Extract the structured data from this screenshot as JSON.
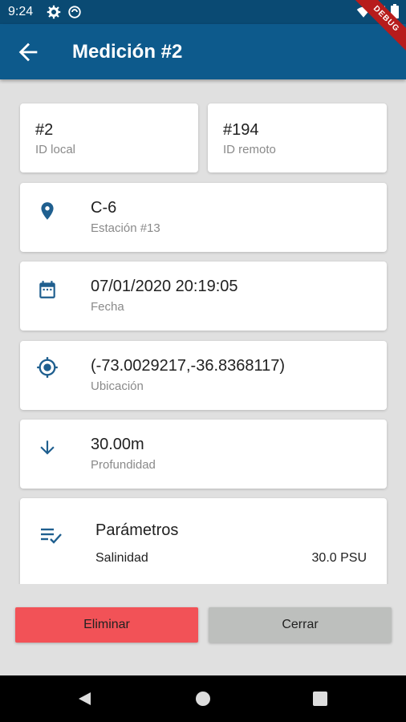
{
  "status_bar": {
    "time": "9:24"
  },
  "app_bar": {
    "title": "Medición #2",
    "debug_label": "DEBUG"
  },
  "ids": {
    "local": {
      "value": "#2",
      "label": "ID local"
    },
    "remote": {
      "value": "#194",
      "label": "ID remoto"
    }
  },
  "station": {
    "value": "C-6",
    "label": "Estación #13",
    "icon": "location-pin-icon"
  },
  "date": {
    "value": "07/01/2020 20:19:05",
    "label": "Fecha",
    "icon": "calendar-icon"
  },
  "location": {
    "value": "(-73.0029217,-36.8368117)",
    "label": "Ubicación",
    "icon": "gps-target-icon"
  },
  "depth": {
    "value": "30.00m",
    "label": "Profundidad",
    "icon": "arrow-down-icon"
  },
  "parameters": {
    "title": "Parámetros",
    "icon": "list-check-icon",
    "items": [
      {
        "name": "Salinidad",
        "value": "30.0 PSU"
      }
    ]
  },
  "actions": {
    "delete_label": "Eliminar",
    "close_label": "Cerrar"
  },
  "colors": {
    "primary": "#0d5a8c",
    "status_bar": "#0a4a73",
    "delete": "#f25257",
    "close": "#bdbfbd",
    "icon": "#1f5f8f"
  }
}
